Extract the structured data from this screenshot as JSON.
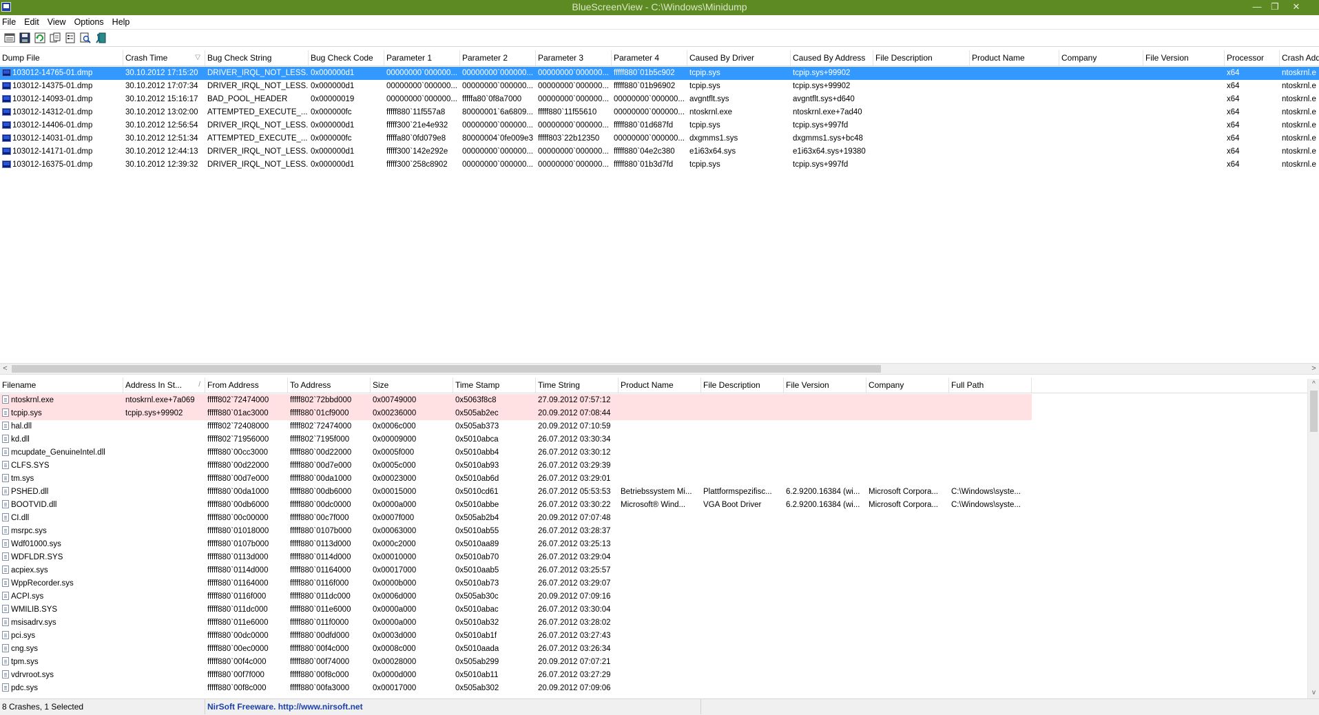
{
  "window": {
    "title": "BlueScreenView  -  C:\\Windows\\Minidump",
    "minimize_glyph": "—",
    "restore_glyph": "❐",
    "close_glyph": "✕"
  },
  "menu": [
    "File",
    "Edit",
    "View",
    "Options",
    "Help"
  ],
  "toolbar_icons": [
    "html-report-icon",
    "save-icon",
    "refresh-icon",
    "copy-icon",
    "properties-icon",
    "find-icon",
    "exit-icon"
  ],
  "top_table": {
    "columns": [
      "Dump File",
      "Crash Time",
      "Bug Check String",
      "Bug Check Code",
      "Parameter 1",
      "Parameter 2",
      "Parameter 3",
      "Parameter 4",
      "Caused By Driver",
      "Caused By Address",
      "File Description",
      "Product Name",
      "Company",
      "File Version",
      "Processor",
      "Crash Add"
    ],
    "sort_indicator": "▽",
    "selected_index": 0,
    "rows": [
      [
        "103012-14765-01.dmp",
        "30.10.2012 17:15:20",
        "DRIVER_IRQL_NOT_LESS...",
        "0x000000d1",
        "00000000`000000...",
        "00000000`000000...",
        "00000000`000000...",
        "fffff880`01b5c902",
        "tcpip.sys",
        "tcpip.sys+99902",
        "",
        "",
        "",
        "",
        "x64",
        "ntoskrnl.e"
      ],
      [
        "103012-14375-01.dmp",
        "30.10.2012 17:07:34",
        "DRIVER_IRQL_NOT_LESS...",
        "0x000000d1",
        "00000000`000000...",
        "00000000`000000...",
        "00000000`000000...",
        "fffff880`01b96902",
        "tcpip.sys",
        "tcpip.sys+99902",
        "",
        "",
        "",
        "",
        "x64",
        "ntoskrnl.e"
      ],
      [
        "103012-14093-01.dmp",
        "30.10.2012 15:16:17",
        "BAD_POOL_HEADER",
        "0x00000019",
        "00000000`000000...",
        "fffffa80`0f8a7000",
        "00000000`000000...",
        "00000000`000000...",
        "avgntflt.sys",
        "avgntflt.sys+d640",
        "",
        "",
        "",
        "",
        "x64",
        "ntoskrnl.e"
      ],
      [
        "103012-14312-01.dmp",
        "30.10.2012 13:02:00",
        "ATTEMPTED_EXECUTE_...",
        "0x000000fc",
        "fffff880`11f557a8",
        "80000001`6a6809...",
        "fffff880`11f55610",
        "00000000`000000...",
        "ntoskrnl.exe",
        "ntoskrnl.exe+7ad40",
        "",
        "",
        "",
        "",
        "x64",
        "ntoskrnl.e"
      ],
      [
        "103012-14406-01.dmp",
        "30.10.2012 12:56:54",
        "DRIVER_IRQL_NOT_LESS...",
        "0x000000d1",
        "fffff300`21e4e932",
        "00000000`000000...",
        "00000000`000000...",
        "fffff880`01d687fd",
        "tcpip.sys",
        "tcpip.sys+997fd",
        "",
        "",
        "",
        "",
        "x64",
        "ntoskrnl.e"
      ],
      [
        "103012-14031-01.dmp",
        "30.10.2012 12:51:34",
        "ATTEMPTED_EXECUTE_...",
        "0x000000fc",
        "fffffa80`0fd079e8",
        "80000004`0fe009e3",
        "fffff803`22b12350",
        "00000000`000000...",
        "dxgmms1.sys",
        "dxgmms1.sys+bc48",
        "",
        "",
        "",
        "",
        "x64",
        "ntoskrnl.e"
      ],
      [
        "103012-14171-01.dmp",
        "30.10.2012 12:44:13",
        "DRIVER_IRQL_NOT_LESS...",
        "0x000000d1",
        "fffff300`142e292e",
        "00000000`000000...",
        "00000000`000000...",
        "fffff880`04e2c380",
        "e1i63x64.sys",
        "e1i63x64.sys+19380",
        "",
        "",
        "",
        "",
        "x64",
        "ntoskrnl.e"
      ],
      [
        "103012-16375-01.dmp",
        "30.10.2012 12:39:32",
        "DRIVER_IRQL_NOT_LESS...",
        "0x000000d1",
        "fffff300`258c8902",
        "00000000`000000...",
        "00000000`000000...",
        "fffff880`01b3d7fd",
        "tcpip.sys",
        "tcpip.sys+997fd",
        "",
        "",
        "",
        "",
        "x64",
        "ntoskrnl.e"
      ]
    ]
  },
  "hscroll": {
    "left_arrow": "<",
    "right_arrow": ">"
  },
  "bottom_table": {
    "columns": [
      "Filename",
      "Address In St...",
      "From Address",
      "To Address",
      "Size",
      "Time Stamp",
      "Time String",
      "Product Name",
      "File Description",
      "File Version",
      "Company",
      "Full Path"
    ],
    "sort_indicator": "/",
    "highlighted_count": 2,
    "rows": [
      [
        "ntoskrnl.exe",
        "ntoskrnl.exe+7a069",
        "fffff802`72474000",
        "fffff802`72bbd000",
        "0x00749000",
        "0x5063f8c8",
        "27.09.2012 07:57:12",
        "",
        "",
        "",
        "",
        ""
      ],
      [
        "tcpip.sys",
        "tcpip.sys+99902",
        "fffff880`01ac3000",
        "fffff880`01cf9000",
        "0x00236000",
        "0x505ab2ec",
        "20.09.2012 07:08:44",
        "",
        "",
        "",
        "",
        ""
      ],
      [
        "hal.dll",
        "",
        "fffff802`72408000",
        "fffff802`72474000",
        "0x0006c000",
        "0x505ab373",
        "20.09.2012 07:10:59",
        "",
        "",
        "",
        "",
        ""
      ],
      [
        "kd.dll",
        "",
        "fffff802`71956000",
        "fffff802`7195f000",
        "0x00009000",
        "0x5010abca",
        "26.07.2012 03:30:34",
        "",
        "",
        "",
        "",
        ""
      ],
      [
        "mcupdate_GenuineIntel.dll",
        "",
        "fffff880`00cc3000",
        "fffff880`00d22000",
        "0x0005f000",
        "0x5010abb4",
        "26.07.2012 03:30:12",
        "",
        "",
        "",
        "",
        ""
      ],
      [
        "CLFS.SYS",
        "",
        "fffff880`00d22000",
        "fffff880`00d7e000",
        "0x0005c000",
        "0x5010ab93",
        "26.07.2012 03:29:39",
        "",
        "",
        "",
        "",
        ""
      ],
      [
        "tm.sys",
        "",
        "fffff880`00d7e000",
        "fffff880`00da1000",
        "0x00023000",
        "0x5010ab6d",
        "26.07.2012 03:29:01",
        "",
        "",
        "",
        "",
        ""
      ],
      [
        "PSHED.dll",
        "",
        "fffff880`00da1000",
        "fffff880`00db6000",
        "0x00015000",
        "0x5010cd61",
        "26.07.2012 05:53:53",
        "Betriebssystem Mi...",
        "Plattformspezifisc...",
        "6.2.9200.16384 (wi...",
        "Microsoft Corpora...",
        "C:\\Windows\\syste..."
      ],
      [
        "BOOTVID.dll",
        "",
        "fffff880`00db6000",
        "fffff880`00dc0000",
        "0x0000a000",
        "0x5010abbe",
        "26.07.2012 03:30:22",
        "Microsoft® Wind...",
        "VGA Boot Driver",
        "6.2.9200.16384 (wi...",
        "Microsoft Corpora...",
        "C:\\Windows\\syste..."
      ],
      [
        "CI.dll",
        "",
        "fffff880`00c00000",
        "fffff880`00c7f000",
        "0x0007f000",
        "0x505ab2b4",
        "20.09.2012 07:07:48",
        "",
        "",
        "",
        "",
        ""
      ],
      [
        "msrpc.sys",
        "",
        "fffff880`01018000",
        "fffff880`0107b000",
        "0x00063000",
        "0x5010ab55",
        "26.07.2012 03:28:37",
        "",
        "",
        "",
        "",
        ""
      ],
      [
        "Wdf01000.sys",
        "",
        "fffff880`0107b000",
        "fffff880`0113d000",
        "0x000c2000",
        "0x5010aa89",
        "26.07.2012 03:25:13",
        "",
        "",
        "",
        "",
        ""
      ],
      [
        "WDFLDR.SYS",
        "",
        "fffff880`0113d000",
        "fffff880`0114d000",
        "0x00010000",
        "0x5010ab70",
        "26.07.2012 03:29:04",
        "",
        "",
        "",
        "",
        ""
      ],
      [
        "acpiex.sys",
        "",
        "fffff880`0114d000",
        "fffff880`01164000",
        "0x00017000",
        "0x5010aab5",
        "26.07.2012 03:25:57",
        "",
        "",
        "",
        "",
        ""
      ],
      [
        "WppRecorder.sys",
        "",
        "fffff880`01164000",
        "fffff880`0116f000",
        "0x0000b000",
        "0x5010ab73",
        "26.07.2012 03:29:07",
        "",
        "",
        "",
        "",
        ""
      ],
      [
        "ACPI.sys",
        "",
        "fffff880`0116f000",
        "fffff880`011dc000",
        "0x0006d000",
        "0x505ab30c",
        "20.09.2012 07:09:16",
        "",
        "",
        "",
        "",
        ""
      ],
      [
        "WMILIB.SYS",
        "",
        "fffff880`011dc000",
        "fffff880`011e6000",
        "0x0000a000",
        "0x5010abac",
        "26.07.2012 03:30:04",
        "",
        "",
        "",
        "",
        ""
      ],
      [
        "msisadrv.sys",
        "",
        "fffff880`011e6000",
        "fffff880`011f0000",
        "0x0000a000",
        "0x5010ab32",
        "26.07.2012 03:28:02",
        "",
        "",
        "",
        "",
        ""
      ],
      [
        "pci.sys",
        "",
        "fffff880`00dc0000",
        "fffff880`00dfd000",
        "0x0003d000",
        "0x5010ab1f",
        "26.07.2012 03:27:43",
        "",
        "",
        "",
        "",
        ""
      ],
      [
        "cng.sys",
        "",
        "fffff880`00ec0000",
        "fffff880`00f4c000",
        "0x0008c000",
        "0x5010aada",
        "26.07.2012 03:26:34",
        "",
        "",
        "",
        "",
        ""
      ],
      [
        "tpm.sys",
        "",
        "fffff880`00f4c000",
        "fffff880`00f74000",
        "0x00028000",
        "0x505ab299",
        "20.09.2012 07:07:21",
        "",
        "",
        "",
        "",
        ""
      ],
      [
        "vdrvroot.sys",
        "",
        "fffff880`00f7f000",
        "fffff880`00f8c000",
        "0x0000d000",
        "0x5010ab11",
        "26.07.2012 03:27:29",
        "",
        "",
        "",
        "",
        ""
      ],
      [
        "pdc.sys",
        "",
        "fffff880`00f8c000",
        "fffff880`00fa3000",
        "0x00017000",
        "0x505ab302",
        "20.09.2012 07:09:06",
        "",
        "",
        "",
        "",
        ""
      ]
    ]
  },
  "vscroll": {
    "up_arrow": "^",
    "down_arrow": "v"
  },
  "status": {
    "count_text": "8 Crashes, 1 Selected",
    "freeware_text": "NirSoft Freeware.  http://www.nirsoft.net"
  }
}
